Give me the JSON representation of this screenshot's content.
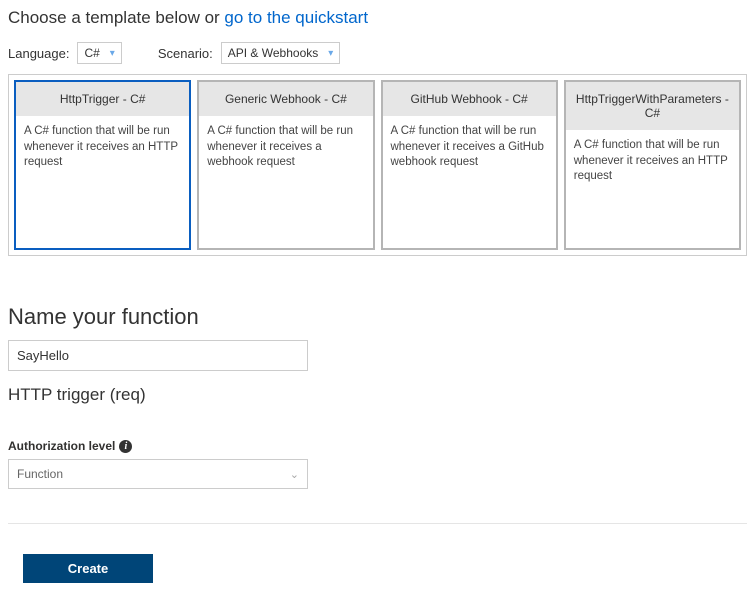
{
  "top": {
    "prefix": "Choose a template below or ",
    "link": "go to the quickstart"
  },
  "selectors": {
    "language_label": "Language:",
    "language_value": "C#",
    "scenario_label": "Scenario:",
    "scenario_value": "API & Webhooks"
  },
  "templates": {
    "items": [
      {
        "title": "HttpTrigger - C#",
        "desc": "A C# function that will be run whenever it receives an HTTP request",
        "selected": true
      },
      {
        "title": "Generic Webhook - C#",
        "desc": "A C# function that will be run whenever it receives a webhook request",
        "selected": false
      },
      {
        "title": "GitHub Webhook - C#",
        "desc": "A C# function that will be run whenever it receives a GitHub webhook request",
        "selected": false
      },
      {
        "title": "HttpTriggerWithParameters - C#",
        "desc": "A C# function that will be run whenever it receives an HTTP request",
        "selected": false
      }
    ]
  },
  "name_section": {
    "heading": "Name your function",
    "value": "SayHello"
  },
  "trigger_heading": "HTTP trigger (req)",
  "auth": {
    "label": "Authorization level",
    "value": "Function"
  },
  "create_label": "Create"
}
